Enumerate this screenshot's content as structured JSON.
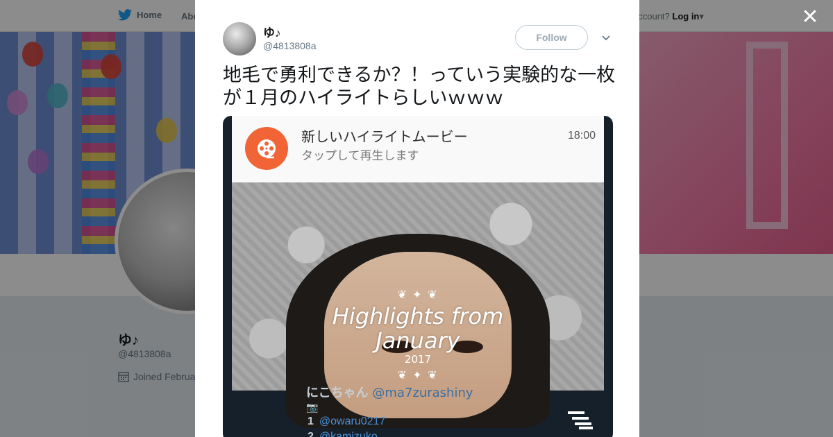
{
  "header": {
    "home_label": "Home",
    "about_label": "Abo",
    "login_prompt": "account?",
    "login_label": "Log in"
  },
  "profile": {
    "name": "ゆ♪",
    "handle": "@4813808a",
    "joined": "Joined Februa"
  },
  "modal": {
    "close_icon": "close-icon",
    "author_name": "ゆ♪",
    "author_handle": "@4813808a",
    "follow_label": "Follow",
    "tweet_text": "地毛で勇利できるか？！っていう実験的な一枚が１月のハイライトらしいｗｗｗ",
    "media": {
      "notification_title": "新しいハイライトムービー",
      "notification_subtitle": "タップして再生します",
      "notification_time": "18:00",
      "highlight_line1": "Highlights from",
      "highlight_line2": "January",
      "highlight_year": "2017",
      "below_name": "にこちゃん",
      "below_handle": "@ma7zurashiny",
      "list": [
        {
          "rank": "1",
          "handle": "@owaru0217"
        },
        {
          "rank": "2",
          "handle": "@kamizuko"
        }
      ]
    }
  },
  "colors": {
    "twitter_blue": "#1da1f2",
    "notification_accent": "#f06436",
    "follow_border": "#b9cbd6"
  }
}
